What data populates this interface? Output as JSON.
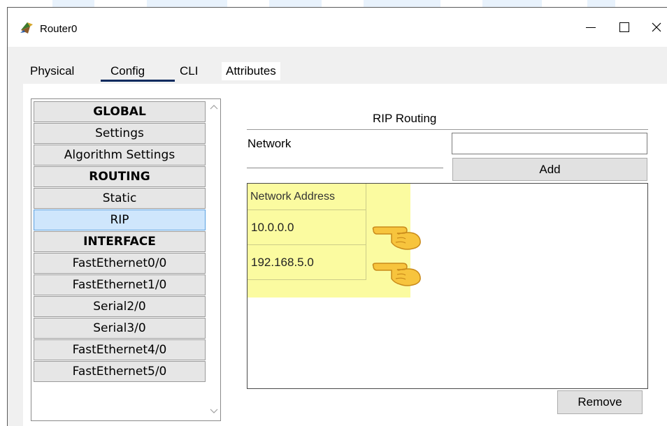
{
  "window": {
    "title": "Router0",
    "controls": [
      "minimize-icon",
      "maximize-icon",
      "close-icon"
    ]
  },
  "tabs": [
    {
      "label": "Physical",
      "active": false
    },
    {
      "label": "Config",
      "active": true
    },
    {
      "label": "CLI",
      "active": false
    },
    {
      "label": "Attributes",
      "active": false
    }
  ],
  "nav": {
    "items": [
      {
        "label": "GLOBAL",
        "header": true
      },
      {
        "label": "Settings"
      },
      {
        "label": "Algorithm Settings"
      },
      {
        "label": "ROUTING",
        "header": true
      },
      {
        "label": "Static"
      },
      {
        "label": "RIP",
        "selected": true
      },
      {
        "label": "INTERFACE",
        "header": true
      },
      {
        "label": "FastEthernet0/0"
      },
      {
        "label": "FastEthernet1/0"
      },
      {
        "label": "Serial2/0"
      },
      {
        "label": "Serial3/0"
      },
      {
        "label": "FastEthernet4/0"
      },
      {
        "label": "FastEthernet5/0"
      }
    ]
  },
  "rip": {
    "title": "RIP Routing",
    "network_label": "Network",
    "network_value": "",
    "add_label": "Add",
    "remove_label": "Remove",
    "table": {
      "column": "Network Address",
      "rows": [
        "10.0.0.0",
        "192.168.5.0"
      ]
    }
  },
  "colors": {
    "highlight": "#fbfba0",
    "selected_item": "#cfe6fc",
    "tab_underline": "#0a2a5e"
  },
  "icons": {
    "app": "router-icon",
    "pointer": "pointing-hand-icon"
  }
}
